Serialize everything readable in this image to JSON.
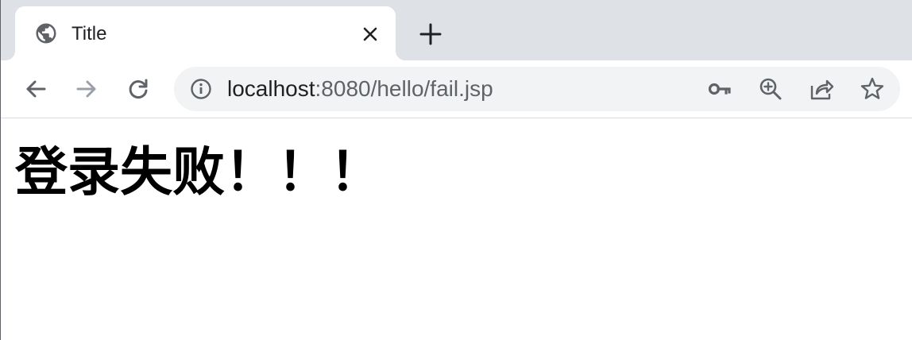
{
  "tab": {
    "title": "Title",
    "favicon": "globe-icon"
  },
  "toolbar": {
    "back_icon": "back-arrow-icon",
    "forward_icon": "forward-arrow-icon",
    "reload_icon": "reload-icon"
  },
  "omnibox": {
    "host": "localhost",
    "path": ":8080/hello/fail.jsp",
    "icons": [
      "info-icon",
      "key-icon",
      "zoom-in-icon",
      "share-icon",
      "star-icon"
    ]
  },
  "page": {
    "heading": "登录失败！！！"
  },
  "colors": {
    "tabstrip": "#dee1e6",
    "omnibox": "#f1f3f4",
    "icon": "#5f6368",
    "icon_disabled": "#9aa0a6",
    "text": "#202124"
  }
}
